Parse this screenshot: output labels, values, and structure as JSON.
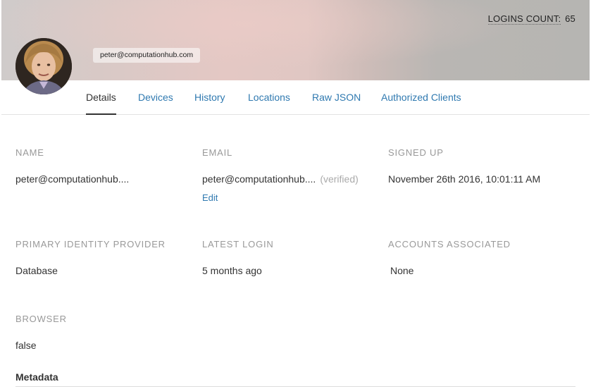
{
  "header": {
    "logins_label": "LOGINS COUNT:",
    "logins_value": "65",
    "email_chip": "peter@computationhub.com"
  },
  "tabs": [
    {
      "label": "Details",
      "active": true
    },
    {
      "label": "Devices",
      "active": false
    },
    {
      "label": "History",
      "active": false
    },
    {
      "label": "Locations",
      "active": false
    },
    {
      "label": "Raw JSON",
      "active": false
    },
    {
      "label": "Authorized Clients",
      "active": false
    }
  ],
  "details": {
    "name_label": "NAME",
    "name_value": "peter@computationhub....",
    "email_label": "EMAIL",
    "email_value": "peter@computationhub....",
    "email_status": "(verified)",
    "email_edit": "Edit",
    "signed_up_label": "SIGNED UP",
    "signed_up_value": "November 26th 2016, 10:01:11 AM",
    "primary_idp_label": "PRIMARY IDENTITY PROVIDER",
    "primary_idp_value": "Database",
    "latest_login_label": "LATEST LOGIN",
    "latest_login_value": "5 months ago",
    "accounts_label": "ACCOUNTS ASSOCIATED",
    "accounts_value": "None",
    "browser_label": "BROWSER",
    "browser_value": "false"
  },
  "metadata_title": "Metadata",
  "colors": {
    "link": "#2f79b0",
    "label": "#999999",
    "text": "#333333"
  }
}
